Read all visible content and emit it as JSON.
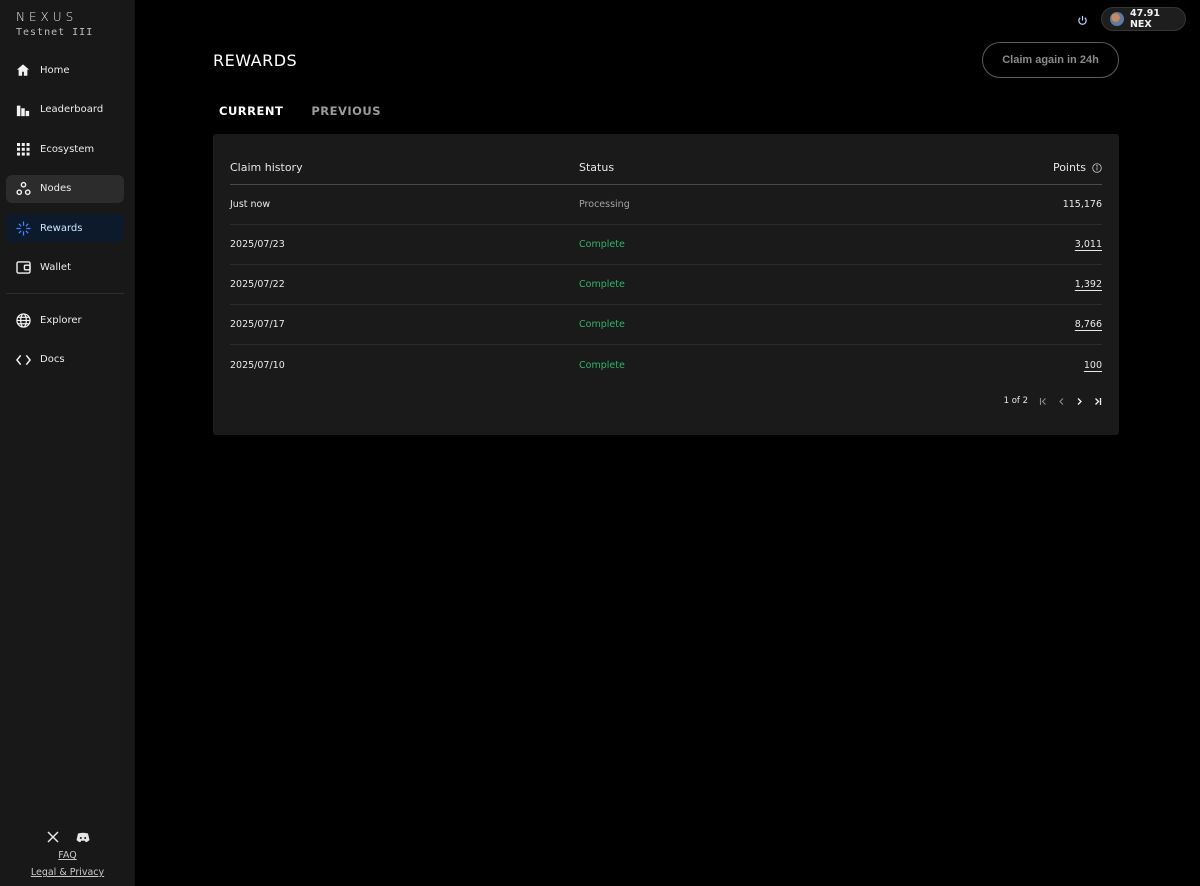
{
  "brand": {
    "name": "NEXUS",
    "subtitle": "Testnet III"
  },
  "nav": {
    "items": [
      {
        "label": "Home",
        "icon": "home-icon"
      },
      {
        "label": "Leaderboard",
        "icon": "bar-chart-icon"
      },
      {
        "label": "Ecosystem",
        "icon": "grid-icon"
      },
      {
        "label": "Nodes",
        "icon": "nodes-icon",
        "state": "hover"
      },
      {
        "label": "Rewards",
        "icon": "sparkle-icon",
        "state": "active"
      },
      {
        "label": "Wallet",
        "icon": "wallet-icon"
      }
    ],
    "secondary": [
      {
        "label": "Explorer",
        "icon": "globe-icon"
      },
      {
        "label": "Docs",
        "icon": "code-icon"
      }
    ]
  },
  "footer": {
    "faq": "FAQ",
    "legal": "Legal & Privacy",
    "social": [
      "x-icon",
      "discord-icon"
    ]
  },
  "topbar": {
    "balance": "47.91 NEX"
  },
  "page": {
    "title": "REWARDS",
    "claim_button": "Claim again in 24h",
    "tabs": [
      {
        "label": "CURRENT",
        "active": true
      },
      {
        "label": "PREVIOUS",
        "active": false
      }
    ]
  },
  "table": {
    "headers": {
      "claim": "Claim history",
      "status": "Status",
      "points": "Points"
    },
    "rows": [
      {
        "claim": "Just now",
        "status": "Processing",
        "points": "115,176",
        "link": false
      },
      {
        "claim": "2025/07/23",
        "status": "Complete",
        "points": "3,011",
        "link": true
      },
      {
        "claim": "2025/07/22",
        "status": "Complete",
        "points": "1,392",
        "link": true
      },
      {
        "claim": "2025/07/17",
        "status": "Complete",
        "points": "8,766",
        "link": true
      },
      {
        "claim": "2025/07/10",
        "status": "Complete",
        "points": "100",
        "link": true
      }
    ],
    "pagination": {
      "text": "1 of 2"
    }
  },
  "colors": {
    "complete": "#2fb36a",
    "processing": "#a3a3a3",
    "active_nav_bg": "#0c1a2c",
    "accent": "#3d8bff"
  }
}
